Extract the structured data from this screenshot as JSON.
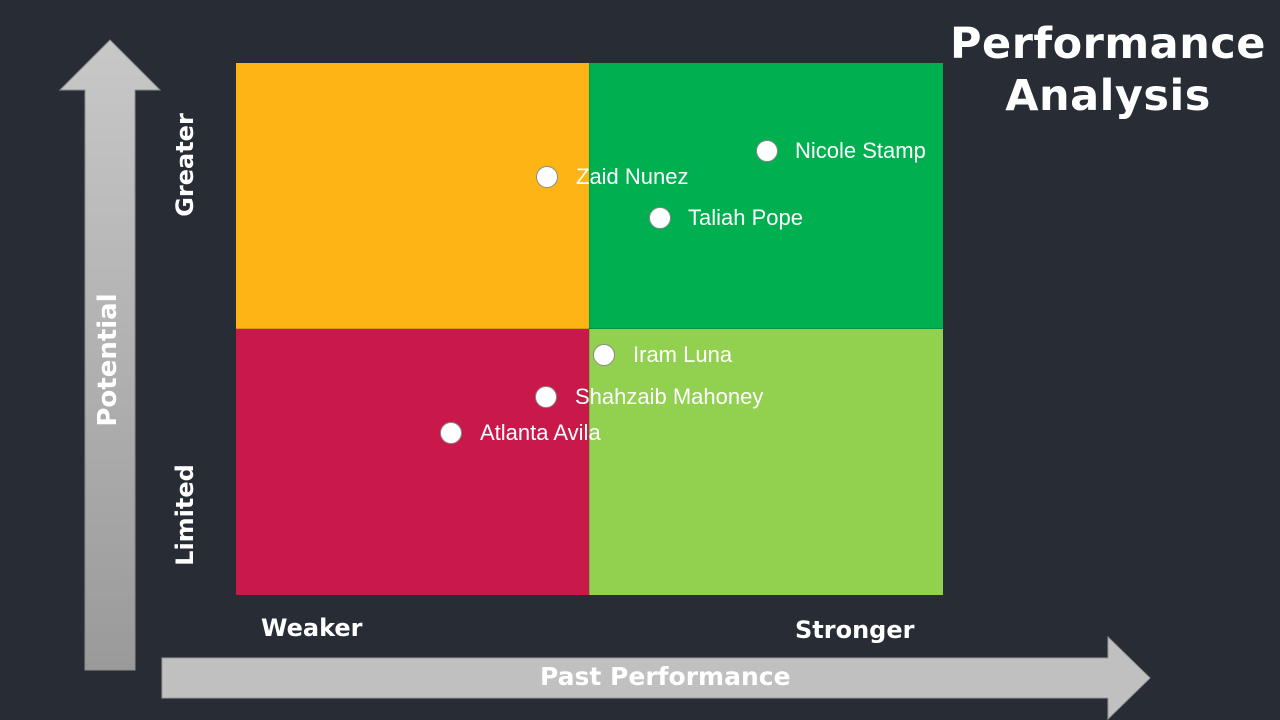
{
  "title": {
    "line1": "Performance",
    "line2": "Analysis"
  },
  "y_axis": {
    "label": "Potential",
    "high": "Greater",
    "low": "Limited"
  },
  "x_axis": {
    "label": "Past Performance",
    "low": "Weaker",
    "high": "Stronger"
  },
  "colors": {
    "background": "#282c35",
    "top_left": "#fdb515",
    "top_right": "#00b050",
    "bottom_left": "#c8194a",
    "bottom_right": "#92d050",
    "arrow": "#c0c0c0"
  },
  "people": [
    {
      "name": "Nicole Stamp"
    },
    {
      "name": "Zaid Nunez"
    },
    {
      "name": "Taliah Pope"
    },
    {
      "name": "Iram Luna"
    },
    {
      "name": "Shahzaib Mahoney"
    },
    {
      "name": "Atlanta Avila"
    }
  ]
}
